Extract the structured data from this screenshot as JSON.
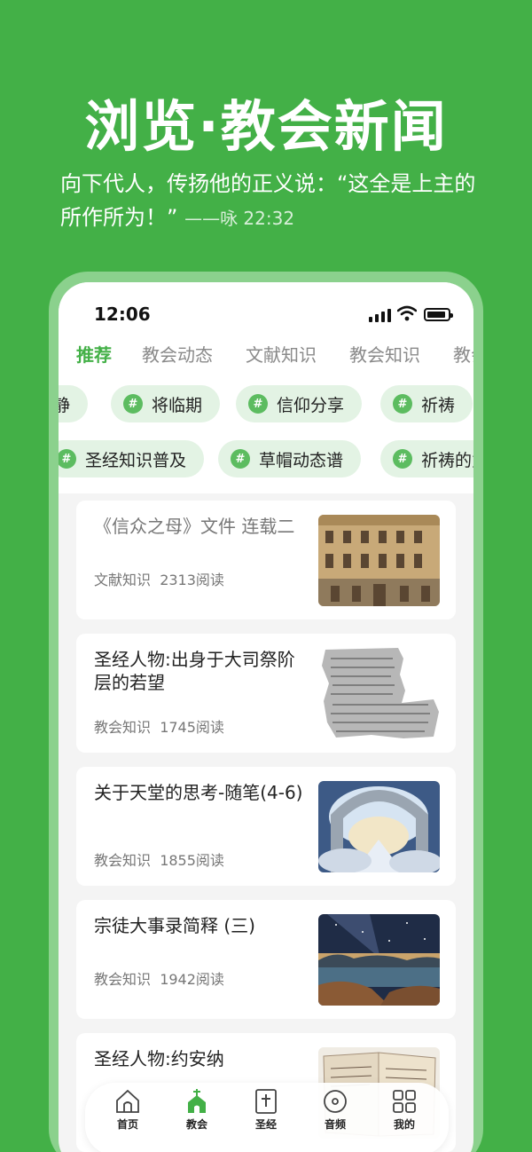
{
  "hero": {
    "title": "浏览·教会新闻",
    "subtitle": "向下代人，传扬他的正义说：“这全是上主的所作所为！”",
    "reference": "——咏 22:32"
  },
  "status_bar": {
    "time": "12:06"
  },
  "tabs": [
    "推荐",
    "教会动态",
    "文献知识",
    "教会知识",
    "教会"
  ],
  "tags_row1": [
    "静",
    "将临期",
    "信仰分享",
    "祈祷"
  ],
  "tags_row2": [
    "圣经知识普及",
    "草帽动态谱",
    "祈祷的力"
  ],
  "articles": [
    {
      "title": "《信众之母》文件 连载二",
      "category": "文献知识",
      "reads": "2313阅读",
      "image": "building-photo"
    },
    {
      "title": "圣经人物:出身于大司祭阶层的若望",
      "category": "教会知识",
      "reads": "1745阅读",
      "image": "scroll-fragment-photo"
    },
    {
      "title": "关于天堂的思考-随笔(4-6)",
      "category": "教会知识",
      "reads": "1855阅读",
      "image": "heaven-gate-photo"
    },
    {
      "title": "宗徒大事录简释 (三)",
      "category": "教会知识",
      "reads": "1942阅读",
      "image": "night-lake-photo"
    },
    {
      "title": "圣经人物:约安纳",
      "category": "",
      "reads": "",
      "image": "old-book-photo"
    }
  ],
  "bottom_nav": [
    {
      "label": "首页",
      "icon": "home-icon"
    },
    {
      "label": "教会",
      "icon": "church-icon"
    },
    {
      "label": "圣经",
      "icon": "bible-icon"
    },
    {
      "label": "音频",
      "icon": "audio-disc-icon"
    },
    {
      "label": "我的",
      "icon": "grid-icon"
    }
  ],
  "colors": {
    "brand": "#43b047",
    "chip_bg": "#e3f3e4",
    "active_tab": "#43b047"
  }
}
